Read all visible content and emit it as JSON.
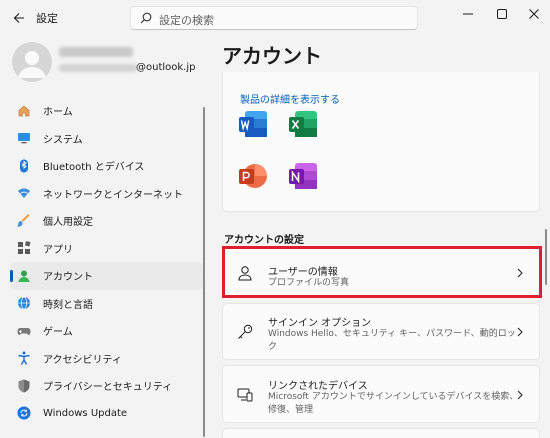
{
  "app": {
    "title": "設定"
  },
  "search": {
    "placeholder": "設定の検索"
  },
  "profile": {
    "email_domain": "@outlook.jp"
  },
  "nav": {
    "items": [
      {
        "label": "ホーム",
        "icon": "home-icon"
      },
      {
        "label": "システム",
        "icon": "system-icon"
      },
      {
        "label": "Bluetooth とデバイス",
        "icon": "bluetooth-icon"
      },
      {
        "label": "ネットワークとインターネット",
        "icon": "wifi-icon"
      },
      {
        "label": "個人用設定",
        "icon": "brush-icon"
      },
      {
        "label": "アプリ",
        "icon": "apps-icon"
      },
      {
        "label": "アカウント",
        "icon": "account-icon",
        "active": true
      },
      {
        "label": "時刻と言語",
        "icon": "globe-clock-icon"
      },
      {
        "label": "ゲーム",
        "icon": "gamepad-icon"
      },
      {
        "label": "アクセシビリティ",
        "icon": "accessibility-icon"
      },
      {
        "label": "プライバシーとセキュリティ",
        "icon": "shield-icon"
      },
      {
        "label": "Windows Update",
        "icon": "update-icon"
      }
    ]
  },
  "main": {
    "title": "アカウント",
    "products": {
      "link": "製品の詳細を表示する",
      "apps": [
        "word-icon",
        "excel-icon",
        "powerpoint-icon",
        "onenote-icon"
      ]
    },
    "section_title": "アカウントの設定",
    "settings": [
      {
        "title": "ユーザーの情報",
        "subtitle": "プロファイルの写真",
        "icon": "person-icon"
      },
      {
        "title": "サインイン オプション",
        "subtitle_line1": "Windows Hello、セキュリティ キー、パスワード、動的ロッ",
        "subtitle_line2": "ク",
        "icon": "key-icon"
      },
      {
        "title": "リンクされたデバイス",
        "subtitle_line1": "Microsoft アカウントでサインインしているデバイスを検索、",
        "subtitle_line2": "修復、管理",
        "icon": "devices-icon"
      }
    ]
  },
  "colors": {
    "accent": "#005fb8",
    "highlight": "#e01e2e"
  }
}
